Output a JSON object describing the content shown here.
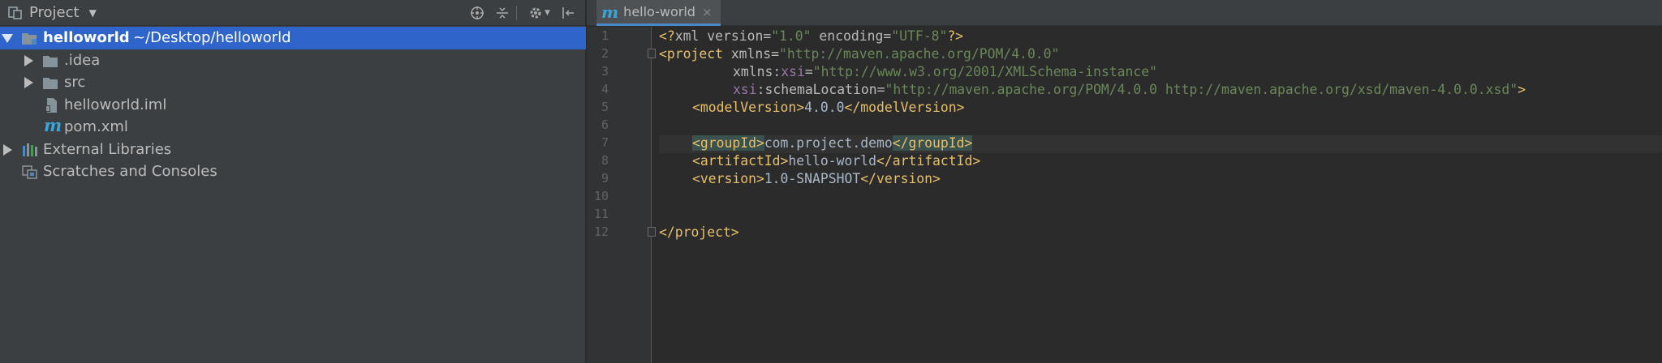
{
  "project_panel": {
    "title": "Project",
    "tree": [
      {
        "label": "helloworld",
        "path": "~/Desktop/helloworld",
        "selected": true
      },
      {
        "label": ".idea"
      },
      {
        "label": "src"
      },
      {
        "label": "helloworld.iml"
      },
      {
        "label": "pom.xml"
      },
      {
        "label": "External Libraries"
      },
      {
        "label": "Scratches and Consoles"
      }
    ]
  },
  "editor": {
    "tab": {
      "icon_letter": "m",
      "label": "hello-world",
      "close": "×"
    },
    "line_numbers": [
      "1",
      "2",
      "3",
      "4",
      "5",
      "6",
      "7",
      "8",
      "9",
      "10",
      "11",
      "12"
    ],
    "code": {
      "l1": [
        "<?",
        "xml ",
        "version",
        "=",
        "\"1.0\"",
        " ",
        "encoding",
        "=",
        "\"UTF-8\"",
        "?>"
      ],
      "l2": [
        "<project ",
        "xmlns",
        "=",
        "\"http://maven.apache.org/POM/4.0.0\""
      ],
      "l3": [
        "xmlns",
        ":",
        "xsi",
        "=",
        "\"http://www.w3.org/2001/XMLSchema-instance\""
      ],
      "l4": [
        "xsi",
        ":schemaLocation=",
        "\"http://maven.apache.org/POM/4.0.0 http://maven.apache.org/xsd/maven-4.0.0.xsd\"",
        ">"
      ],
      "l5": [
        "<modelVersion>",
        "4.0.0",
        "</modelVersion>"
      ],
      "l7": [
        "<groupId>",
        "com.project.demo",
        "</groupId>"
      ],
      "l8": [
        "<artifactId>",
        "hello-world",
        "</artifactId>"
      ],
      "l9": [
        "<version>",
        "1.0-SNAPSHOT",
        "</version>"
      ],
      "l12": [
        "</project>"
      ]
    }
  },
  "colors": {
    "selection": "#2f65ca",
    "tag": "#e8bf6a",
    "string": "#6a8759",
    "namespace": "#9876aa",
    "text": "#a9b7c6"
  }
}
